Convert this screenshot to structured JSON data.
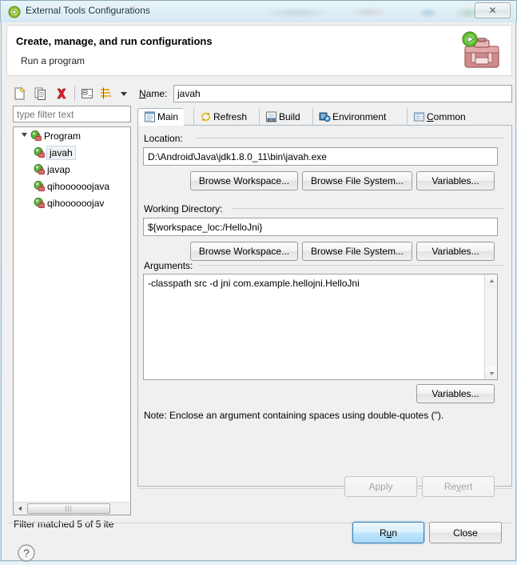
{
  "window": {
    "title": "External Tools Configurations",
    "title_icon": "eclipse-launch-icon",
    "close_label": "✕"
  },
  "header": {
    "title": "Create, manage, and run configurations",
    "subtitle": "Run a program",
    "icon": "toolbox-run-icon"
  },
  "tree_toolbar": {
    "buttons": [
      {
        "name": "new-configuration-icon",
        "tooltip": "New launch configuration"
      },
      {
        "name": "duplicate-configuration-icon",
        "tooltip": "Duplicate"
      },
      {
        "name": "delete-configuration-icon",
        "tooltip": "Delete"
      },
      {
        "name": "collapse-all-icon",
        "tooltip": "Collapse All"
      },
      {
        "name": "filter-icon",
        "tooltip": "Filter launch configurations"
      },
      {
        "name": "view-menu-chevron-icon",
        "tooltip": "View Menu"
      }
    ]
  },
  "filter": {
    "placeholder": "type filter text",
    "value": "",
    "status": "Filter matched 5 of 5 ite"
  },
  "tree": {
    "root": {
      "label": "Program",
      "expanded": true,
      "icon": "program-config-icon"
    },
    "children": [
      {
        "label": "javah",
        "icon": "program-config-icon",
        "selected": true
      },
      {
        "label": "javap",
        "icon": "program-config-icon",
        "selected": false
      },
      {
        "label": "qihoooooojava",
        "icon": "program-config-icon",
        "selected": false
      },
      {
        "label": "qihoooooojav",
        "icon": "program-config-icon",
        "selected": false
      }
    ]
  },
  "config": {
    "name_label_pre": "N",
    "name_label_post": "ame:",
    "name_value": "javah"
  },
  "tabs": [
    {
      "label": "Main",
      "icon": "main-tab-icon",
      "active": true,
      "mnemonic": ""
    },
    {
      "label": "Refresh",
      "icon": "refresh-tab-icon",
      "active": false,
      "mnemonic": ""
    },
    {
      "label": "Build",
      "icon": "build-tab-icon",
      "active": false,
      "mnemonic": ""
    },
    {
      "label": "Environment",
      "icon": "environment-tab-icon",
      "active": false,
      "mnemonic": ""
    },
    {
      "label": "Common",
      "icon": "common-tab-icon",
      "active": false,
      "mnemonic": "C"
    }
  ],
  "main_tab": {
    "location": {
      "label": "Location:",
      "value": "D:\\Android\\Java\\jdk1.8.0_11\\bin\\javah.exe",
      "browse_workspace": "Browse Workspace...",
      "browse_filesystem": "Browse File System...",
      "variables": "Variables..."
    },
    "working_directory": {
      "label": "Working Directory:",
      "value": "${workspace_loc:/HelloJni}",
      "browse_workspace": "Browse Workspace...",
      "browse_filesystem": "Browse File System...",
      "variables": "Variables..."
    },
    "arguments": {
      "label": "Arguments:",
      "value": "-classpath src -d jni com.example.hellojni.HelloJni",
      "variables": "Variables...",
      "note": "Note: Enclose an argument containing spaces using double-quotes (\")."
    }
  },
  "actions": {
    "apply": "Apply",
    "apply_enabled": false,
    "revert_pre": "Re",
    "revert_mnemonic": "v",
    "revert_post": "ert",
    "revert_enabled": false,
    "run_pre": "R",
    "run_mnemonic": "u",
    "run_post": "n",
    "close": "Close",
    "help_icon": "help-question-icon"
  },
  "colors": {
    "accent_blue": "#3c7fb1",
    "default_button_fill": "#bee6fd",
    "dialog_bg": "#f0f0f0",
    "tab_border": "#a6b7c6",
    "delete_red": "#d8232a",
    "run_green": "#4fb33c"
  }
}
